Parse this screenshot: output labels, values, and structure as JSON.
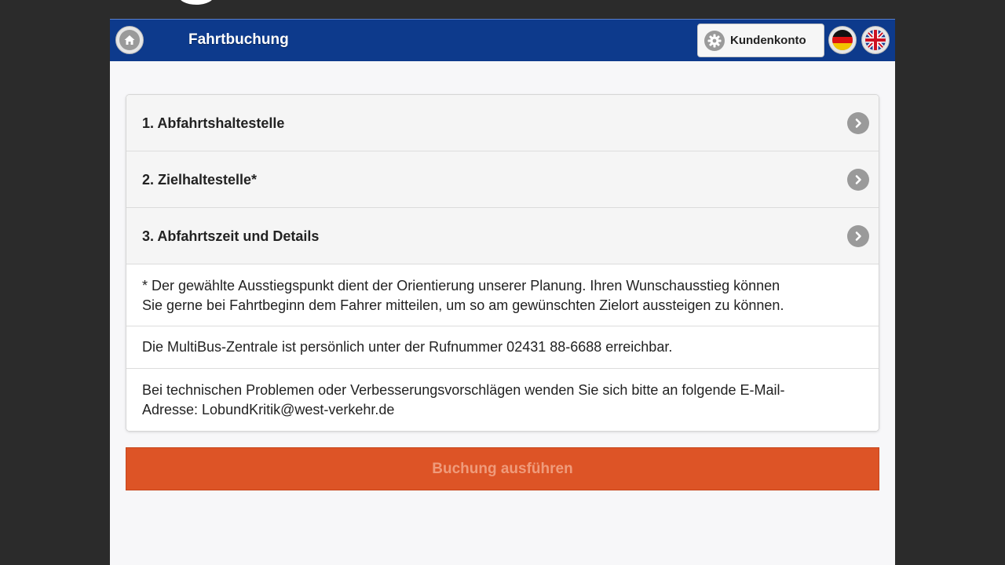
{
  "header": {
    "title": "Fahrtbuchung",
    "account_label": "Kundenkonto"
  },
  "steps": [
    {
      "label": "1. Abfahrtshaltestelle"
    },
    {
      "label": "2. Zielhaltestelle*"
    },
    {
      "label": "3. Abfahrtszeit und Details"
    }
  ],
  "info": {
    "note_line1": "* Der gewählte Ausstiegspunkt dient der Orientierung unserer Planung. Ihren Wunschausstieg können",
    "note_line2": "Sie gerne bei Fahrtbeginn dem Fahrer mitteilen, um so am gewünschten Zielort aussteigen zu können.",
    "phone": "Die MultiBus-Zentrale ist persönlich unter der Rufnummer 02431 88-6688 erreichbar.",
    "support_line1": "Bei technischen Problemen oder Verbesserungsvorschlägen wenden Sie sich bitte an folgende E-Mail-",
    "support_line2": "Adresse: LobundKritik@west-verkehr.de"
  },
  "submit_label": "Buchung ausführen",
  "icons": {
    "home": "home-icon",
    "gear": "gear-icon",
    "chevron": "chevron-right-icon",
    "flag_de": "flag-de-icon",
    "flag_uk": "flag-uk-icon"
  },
  "colors": {
    "header_bg": "#0d3a8c",
    "submit_bg": "#dd5426",
    "submit_text": "#ef9b7b",
    "icon_grey": "#9a9a9a"
  }
}
